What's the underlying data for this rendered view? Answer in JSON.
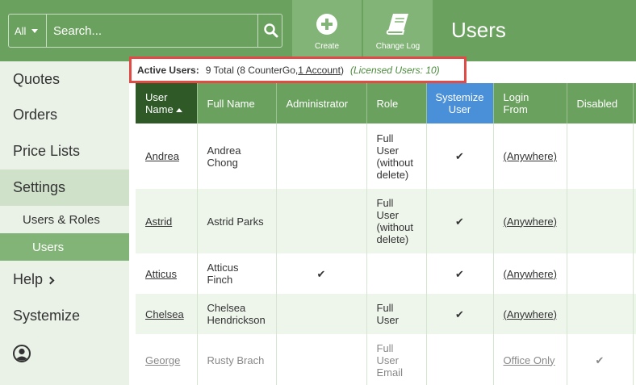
{
  "search": {
    "scope": "All",
    "placeholder": "Search..."
  },
  "toolbar": {
    "create_label": "Create",
    "changelog_label": "Change Log"
  },
  "page_title": "Users",
  "sidebar": {
    "items": [
      {
        "label": "Quotes"
      },
      {
        "label": "Orders"
      },
      {
        "label": "Price Lists"
      },
      {
        "label": "Settings"
      },
      {
        "label": "Users & Roles"
      },
      {
        "label": "Users"
      },
      {
        "label": "Help"
      },
      {
        "label": "Systemize"
      }
    ]
  },
  "banner": {
    "label": "Active Users:",
    "summary_pre": "9 Total (8 CounterGo, ",
    "account_link": "1 Account",
    "summary_post": ")",
    "licensed": "(Licensed Users: 10)"
  },
  "table": {
    "headers": {
      "username_line1": "User",
      "username_line2": "Name",
      "fullname": "Full Name",
      "admin": "Administrator",
      "role": "Role",
      "systemize_line1": "Systemize",
      "systemize_line2": "User",
      "login_line1": "Login",
      "login_line2": "From",
      "disabled": "Disabled"
    },
    "rows": [
      {
        "username": "Andrea",
        "fullname_1": "Andrea",
        "fullname_2": "Chong",
        "admin": "",
        "role_1": "Full",
        "role_2": "User",
        "role_3": "(without",
        "role_4": "delete)",
        "systemize": "✔",
        "login": "(Anywhere)",
        "disabled": ""
      },
      {
        "username": "Astrid",
        "fullname_1": "Astrid Parks",
        "fullname_2": "",
        "admin": "",
        "role_1": "Full",
        "role_2": "User",
        "role_3": "(without",
        "role_4": "delete)",
        "systemize": "✔",
        "login": "(Anywhere)",
        "disabled": ""
      },
      {
        "username": "Atticus",
        "fullname_1": "Atticus",
        "fullname_2": "Finch",
        "admin": "✔",
        "role_1": "",
        "role_2": "",
        "role_3": "",
        "role_4": "",
        "systemize": "✔",
        "login": "(Anywhere)",
        "disabled": ""
      },
      {
        "username": "Chelsea",
        "fullname_1": "Chelsea",
        "fullname_2": "Hendrickson",
        "admin": "",
        "role_1": "Full",
        "role_2": "User",
        "role_3": "",
        "role_4": "",
        "systemize": "✔",
        "login": "(Anywhere)",
        "disabled": ""
      },
      {
        "username": "George",
        "fullname_1": "Rusty Brach",
        "fullname_2": "",
        "admin": "",
        "role_1": "Full",
        "role_2": "User",
        "role_3": "Email",
        "role_4": "",
        "systemize": "",
        "login": "Office Only",
        "disabled": "✔"
      }
    ]
  },
  "colors": {
    "header_green": "#6ba15e",
    "highlight": "#e24a45",
    "systemize_blue": "#4a90d9"
  }
}
